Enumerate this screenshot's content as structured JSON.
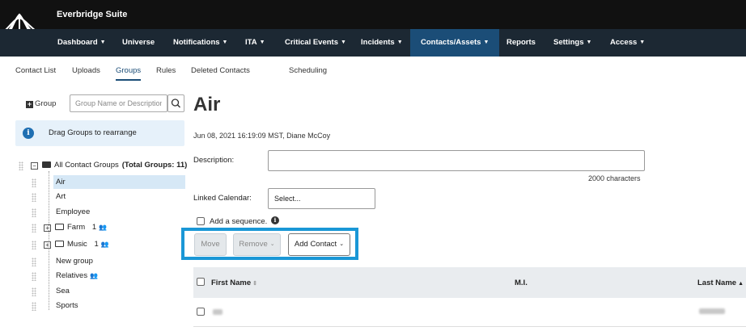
{
  "header": {
    "app_title": "Everbridge Suite",
    "nav": [
      {
        "label": "Dashboard",
        "dropdown": true
      },
      {
        "label": "Universe",
        "dropdown": false
      },
      {
        "label": "Notifications",
        "dropdown": true
      },
      {
        "label": "ITA",
        "dropdown": true
      },
      {
        "label": "Critical Events",
        "dropdown": true
      },
      {
        "label": "Incidents",
        "dropdown": true
      },
      {
        "label": "Contacts/Assets",
        "dropdown": true,
        "active": true
      },
      {
        "label": "Reports",
        "dropdown": false
      },
      {
        "label": "Settings",
        "dropdown": true
      },
      {
        "label": "Access",
        "dropdown": true
      }
    ]
  },
  "subnav": {
    "items": [
      "Contact List",
      "Uploads",
      "Groups",
      "Rules",
      "Deleted Contacts",
      "Scheduling"
    ],
    "active": "Groups"
  },
  "sidebar": {
    "add_group_label": "Group",
    "search_placeholder": "Group Name or Description",
    "info_text": "Drag Groups to rearrange",
    "root_label": "All Contact Groups",
    "total_label": "(Total Groups: 11)",
    "groups": [
      {
        "label": "Air",
        "selected": true
      },
      {
        "label": "Art"
      },
      {
        "label": "Employee"
      },
      {
        "label": "Farm",
        "count": "1",
        "folder": true
      },
      {
        "label": "Music",
        "count": "1",
        "folder": true
      },
      {
        "label": "New group"
      },
      {
        "label": "Relatives",
        "shared": true
      },
      {
        "label": "Sea"
      },
      {
        "label": "Sports"
      }
    ]
  },
  "main": {
    "title": "Air",
    "meta": "Jun 08, 2021 16:19:09 MST, Diane McCoy",
    "description_label": "Description:",
    "description_value": "",
    "char_count": "2000 characters",
    "linked_calendar_label": "Linked Calendar:",
    "linked_calendar_value": "Select...",
    "sequence_label": "Add a sequence.",
    "buttons": {
      "move": "Move",
      "remove": "Remove",
      "add_contact": "Add Contact"
    },
    "table": {
      "columns": [
        "First Name",
        "M.I.",
        "Last Name"
      ]
    }
  },
  "colors": {
    "nav_bg": "#1c2833",
    "nav_active": "#1b4d77",
    "highlight": "#1a97d6",
    "info_bg": "#e6f1fa"
  }
}
